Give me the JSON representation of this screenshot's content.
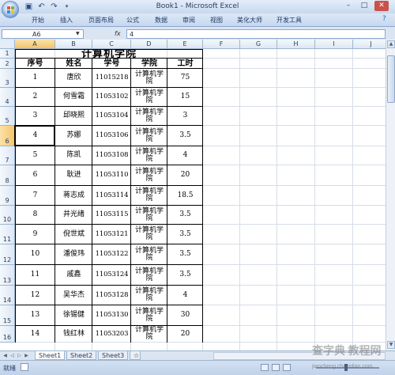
{
  "window": {
    "title": "Book1 - Microsoft Excel",
    "controls": {
      "minimize": "–",
      "maximize": "□",
      "close": "✕"
    },
    "qat": {
      "save": "save-icon",
      "undo": "undo-icon",
      "redo": "redo-icon"
    }
  },
  "ribbon": {
    "tabs": [
      "开始",
      "插入",
      "页面布局",
      "公式",
      "数据",
      "审阅",
      "视图",
      "美化大师",
      "开发工具"
    ]
  },
  "formula_bar": {
    "name_box": "A6",
    "fx_label": "fx",
    "content": "4"
  },
  "grid": {
    "columns": [
      "A",
      "B",
      "C",
      "D",
      "E",
      "F",
      "G",
      "H",
      "I",
      "J"
    ],
    "rows": [
      "1",
      "2",
      "3",
      "4",
      "5",
      "6",
      "7",
      "8",
      "9",
      "10",
      "11",
      "12",
      "13",
      "14",
      "15",
      "16"
    ],
    "selected_cell": "A6",
    "title": "计算机学院",
    "headers": [
      "序号",
      "姓名",
      "学号",
      "学院",
      "工时"
    ],
    "records": [
      [
        "1",
        "唐欣",
        "11015218",
        "计算机学院",
        "75"
      ],
      [
        "2",
        "何雪霜",
        "11053102",
        "计算机学院",
        "15"
      ],
      [
        "3",
        "邱晓熙",
        "11053104",
        "计算机学院",
        "3"
      ],
      [
        "4",
        "苏娜",
        "11053106",
        "计算机学院",
        "3.5"
      ],
      [
        "5",
        "陈凯",
        "11053108",
        "计算机学院",
        "4"
      ],
      [
        "6",
        "耿进",
        "11053110",
        "计算机学院",
        "20"
      ],
      [
        "7",
        "蒋志成",
        "11053114",
        "计算机学院",
        "18.5"
      ],
      [
        "8",
        "井光绪",
        "11053115",
        "计算机学院",
        "3.5"
      ],
      [
        "9",
        "倪世斌",
        "11053121",
        "计算机学院",
        "3.5"
      ],
      [
        "10",
        "潘俊玮",
        "11053122",
        "计算机学院",
        "3.5"
      ],
      [
        "11",
        "戚鑫",
        "11053124",
        "计算机学院",
        "3.5"
      ],
      [
        "12",
        "吴华杰",
        "11053128",
        "计算机学院",
        "4"
      ],
      [
        "13",
        "徐锡健",
        "11053130",
        "计算机学院",
        "30"
      ],
      [
        "14",
        "钱红林",
        "11053203",
        "计算机学院",
        "20"
      ]
    ]
  },
  "sheet_tabs": [
    "Sheet1",
    "Sheet2",
    "Sheet3"
  ],
  "status_bar": {
    "text": "就绪"
  },
  "watermark": {
    "line1": "查字典 教程网",
    "line2": "jiaocheng.chazidian.com"
  },
  "colors": {
    "accent": "#f5c56c",
    "header_bg": "#dde7f3",
    "chrome": "#dbe5f1"
  }
}
